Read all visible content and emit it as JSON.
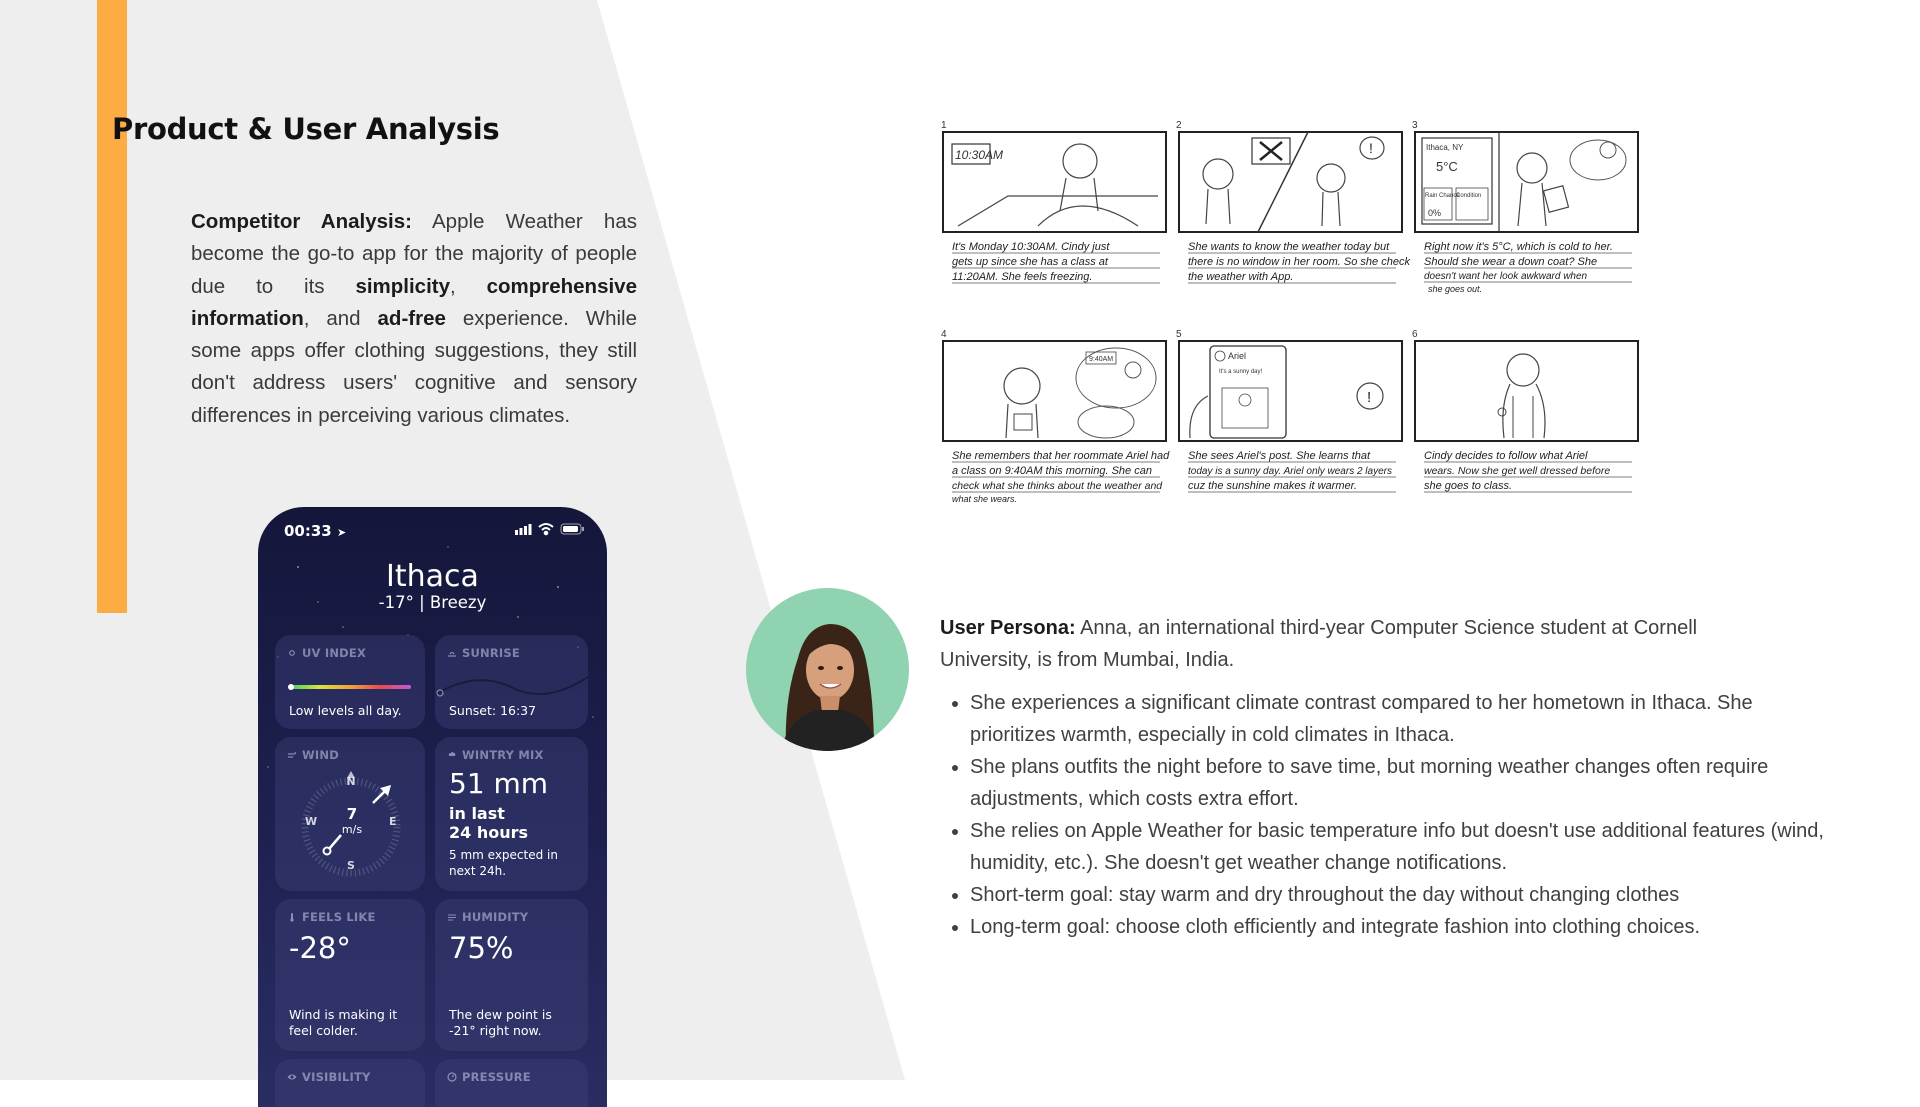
{
  "title": "Product & User Analysis",
  "competitor": {
    "label": "Competitor Analysis:",
    "t1": " Apple Weather has become the go-to app for the majority of people due to its ",
    "b1": "simplicity",
    "t2": ", ",
    "b2": "comprehensive information",
    "t3": ", and ",
    "b3": "ad-free",
    "t4": " experience. While some apps offer clothing suggestions, they still don't address users' cognitive and sensory differences in perceiving various climates."
  },
  "phone": {
    "time": "00:33",
    "city": "Ithaca",
    "condition": "-17°  |  Breezy",
    "cards": {
      "uv": {
        "title": "UV INDEX",
        "text": "Low levels all day.",
        "level": 0.0
      },
      "sunrise": {
        "title": "SUNRISE",
        "text": "Sunset: 16:37"
      },
      "wind": {
        "title": "WIND",
        "speed": "7",
        "unit": "m/s",
        "n": "N",
        "e": "E",
        "s": "S",
        "w": "W"
      },
      "wintry": {
        "title": "WINTRY MIX",
        "amount": "51 mm",
        "period1": "in last",
        "period2": "24 hours",
        "note1": "5 mm expected in",
        "note2": "next 24h."
      },
      "feels": {
        "title": "FEELS LIKE",
        "value": "-28°",
        "note1": "Wind is making it",
        "note2": "feel colder."
      },
      "humidity": {
        "title": "HUMIDITY",
        "value": "75%",
        "note1": "The dew point is",
        "note2": "-21° right now."
      },
      "visibility": {
        "title": "VISIBILITY"
      },
      "pressure": {
        "title": "PRESSURE"
      }
    }
  },
  "storyboard": {
    "panels": [
      {
        "num": "1",
        "scene": "10:30AM",
        "caption": [
          "It's Monday 10:30AM. Cindy just",
          "gets up since she has a class at",
          "11:20AM. She feels freezing."
        ]
      },
      {
        "num": "2",
        "caption": [
          "She wants to know the weather today but",
          "there is no window in her room. So she check",
          "the weather with App."
        ]
      },
      {
        "num": "3",
        "scene": "Ithaca, NY",
        "scene2": "5°C",
        "scene3": "Rain Chance",
        "scene4": "0%",
        "scene5": "Condition",
        "caption": [
          "Right now it's 5°C, which is cold to her.",
          "Should she wear a down coat? She",
          "doesn't want her look awkward when",
          "she goes out."
        ]
      },
      {
        "num": "4",
        "scene": "9:40AM",
        "caption": [
          "She remembers that her roommate Ariel had",
          "a class on 9:40AM this morning. She can",
          "check what she thinks about the weather and",
          "what she wears."
        ]
      },
      {
        "num": "5",
        "scene": "Ariel",
        "scene2": "It's a sunny day!",
        "caption": [
          "She sees Ariel's post. She learns that",
          "today is a sunny day. Ariel only wears 2 layers",
          "cuz the sunshine makes it warmer."
        ]
      },
      {
        "num": "6",
        "caption": [
          "Cindy decides to follow what Ariel",
          "wears. Now she get well dressed before",
          "she goes to class."
        ]
      }
    ]
  },
  "persona": {
    "label": "User Persona:",
    "intro": " Anna, an international third-year Computer Science student at Cornell University, is from Mumbai, India.",
    "bullets": [
      "She experiences a significant climate contrast compared to her hometown in Ithaca. She prioritizes warmth, especially in cold climates in Ithaca.",
      "She plans outfits the night before to save time, but morning weather changes often require adjustments, which costs extra effort.",
      "She relies on Apple Weather for basic temperature info but doesn't use additional features (wind, humidity, etc.). She doesn't get weather change notifications.",
      "Short-term goal: stay warm and dry throughout the day without changing clothes",
      "Long-term goal: choose cloth efficiently and integrate fashion into clothing choices."
    ]
  },
  "colors": {
    "accent": "#FDAC43",
    "panel_bg": "#EEEEEE",
    "avatar_bg": "#8FD3B0",
    "phone_bg": "#1E2150"
  }
}
